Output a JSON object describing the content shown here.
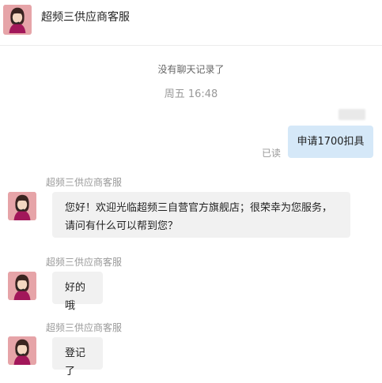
{
  "header": {
    "title": "超频三供应商客服",
    "avatar_icon": "agent-avatar"
  },
  "chat": {
    "no_history": "没有聊天记录了",
    "timestamp": "周五 16:48",
    "outgoing": {
      "text": "申请1700扣具",
      "status": "已读"
    },
    "incoming": [
      {
        "sender": "超频三供应商客服",
        "text": "您好！欢迎光临超频三自营官方旗舰店；很荣幸为您服务，请问有什么可以帮到您？"
      },
      {
        "sender": "超频三供应商客服",
        "text": "好的哦"
      },
      {
        "sender": "超频三供应商客服",
        "text": "登记了"
      }
    ]
  },
  "colors": {
    "outgoing_bubble": "#d5e8f8",
    "incoming_bubble": "#f1f1f1",
    "avatar_bg": "#e6a4a8"
  }
}
